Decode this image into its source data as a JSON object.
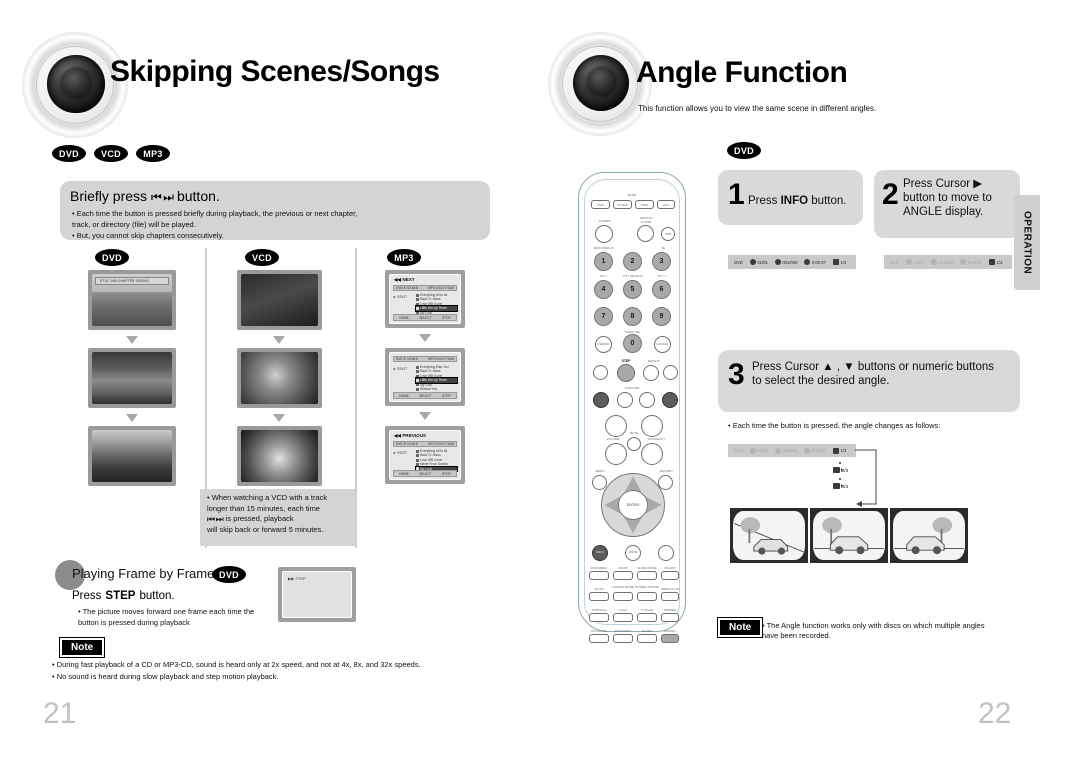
{
  "left_page": {
    "title": "Skipping Scenes/Songs",
    "page_number": "21",
    "media_badges": [
      "DVD",
      "VCD",
      "MP3"
    ],
    "intro_panel": {
      "heading_pre": "Briefly press",
      "heading_glyph": "⏮ ⏭",
      "heading_post": "button.",
      "bullets": [
        "• Each time the button is pressed briefly during playback, the previous or next chapter,",
        "   track, or directory (file) will be played.",
        "• But, you cannot skip chapters consecutively."
      ]
    },
    "columns": [
      {
        "badge": "DVD",
        "screens": [
          {
            "osd": "TITLE 2/45   CHAPTER 002/040",
            "scene": "beach"
          },
          {
            "osd": "",
            "scene": "cactus"
          },
          {
            "osd": "",
            "scene": "river"
          }
        ]
      },
      {
        "badge": "VCD",
        "screens": [
          {
            "osd": "",
            "scene": "dark"
          },
          {
            "osd": "",
            "scene": "chip"
          },
          {
            "osd": "",
            "scene": "raccoon"
          }
        ],
        "note": [
          "• When watching a VCD with a track",
          "   longer than 15 minutes, each time",
          "   is pressed, playback",
          "   will skip back or forward 5 minutes."
        ],
        "note_glyph": "⏮ ⏭"
      },
      {
        "badge": "MP3",
        "screens": [
          {
            "label": "NEXT",
            "bar_left": "DVD-R  02:48:8",
            "bar_right": "MP3  0:04:07  SAM",
            "left_col": "► ROOT",
            "files": [
              "Everything All In All",
              "Back To Jesus",
              "Love Will Cover",
              "Little Girl Up There",
              "My Lord",
              "Without You"
            ],
            "selected": 3,
            "foot": [
              "HOME",
              "SELECT",
              "STOP"
            ]
          },
          {
            "label": "",
            "bar_left": "DVD-R  02:48:8",
            "bar_right": "MP3  0:04:07  SAM",
            "left_col": "► ROOT",
            "files": [
              "Everything Else You",
              "Back To Jesus",
              "Love Will Cover",
              "Little Girl Up There",
              "My Lord",
              "Without You"
            ],
            "selected": 3,
            "foot": [
              "HOME",
              "SELECT",
              "STOP"
            ]
          },
          {
            "label": "PREVIOUS",
            "bar_left": "DVD-R  02:48:8",
            "bar_right": "MP3  0:04:07  SAM",
            "left_col": "► ROOT",
            "files": [
              "Everything All In All",
              "Back To Jesus",
              "Love Will Cover",
              "Never From Sorrow",
              "My Lord",
              "Without You"
            ],
            "selected": 4,
            "foot": [
              "HOME",
              "SELECT",
              "STOP"
            ]
          }
        ]
      }
    ],
    "frame_section": {
      "title": "Playing Frame by Frame",
      "badge": "DVD",
      "instruction_pre": "Press",
      "instruction_bold": "STEP",
      "instruction_post": "button.",
      "bullets": [
        "• The picture moves forward one frame each time the",
        "   button is pressed during playback"
      ],
      "screen_osd": "▶▶ STEP"
    },
    "note_label": "Note",
    "note_bullets": [
      "• During fast playback of a CD or MP3-CD, sound is heard only at 2x speed, and not at 4x, 8x, and 32x speeds.",
      "• No sound is heard during slow playback and step motion playback."
    ]
  },
  "right_page": {
    "title": "Angle Function",
    "subtitle": "This function allows you to view the same scene in different angles.",
    "page_number": "22",
    "media_badge": "DVD",
    "side_tab": "OPERATION",
    "steps": [
      {
        "num": "1",
        "lines": [
          "Press INFO button."
        ],
        "bold_word": "INFO"
      },
      {
        "num": "2",
        "lines": [
          "Press Cursor ▶",
          "button to move to",
          "ANGLE display."
        ]
      },
      {
        "num": "3",
        "lines": [
          "Press Cursor ▲ , ▼ buttons or numeric buttons",
          "to select the desired angle."
        ]
      }
    ],
    "osd_bar_active": {
      "disc": "DVD",
      "title": "01/01",
      "chapter": "001/040",
      "time": "0:00:37",
      "angle": "1/3"
    },
    "osd_bar_dim": {
      "disc": "DVD",
      "title": "01/01",
      "chapter": "001/040",
      "time": "0:00:37",
      "angle": "1/3"
    },
    "step3_bullet": "• Each time the button is pressed, the angle changes as follows:",
    "angle_cycle": [
      "1/3",
      "2/3",
      "3/3"
    ],
    "car_views": [
      "angle-1",
      "angle-2",
      "angle-3"
    ],
    "note_label": "Note",
    "note_bullets": [
      "• The Angle function works only with discs on which multiple angles",
      "   have been recorded."
    ],
    "remote": {
      "band_label": "BAND",
      "source_buttons": [
        "DVD",
        "TUNER",
        "TAPE",
        "AUX"
      ],
      "power_label": "POWER",
      "display_label": "DISPLAY\nCLOSE",
      "usb_label": "USB",
      "rds_label": "RDS DISPLAY",
      "ta_label": "TA",
      "pty_minus": "PTY -",
      "pty_search": "PTY SEARCH",
      "pty_plus": "PTY +",
      "numbers": [
        "1",
        "2",
        "3",
        "4",
        "5",
        "6",
        "7",
        "8",
        "9",
        "0"
      ],
      "video_sel": "VIDEO SEL.",
      "remain": "REMAIN",
      "cancel": "CANCEL",
      "step": "STEP",
      "repeat": "REPEAT",
      "dvd_usb": "DVD/USB",
      "volume": "VOLUME",
      "mute": "MUTE",
      "tuning": "TUNING/CH",
      "menu": "MENU",
      "return": "RETURN",
      "enter": "ENTER",
      "info": "INFO",
      "mode": "MODE",
      "sleep_grid": [
        [
          "DVD MENU",
          "ZOOM",
          "SLIDE MODE",
          "DIGEST"
        ],
        [
          "SLOW",
          "TUNING MODE",
          "POWER SOUND",
          "REPEAT A-B"
        ],
        [
          "SUBTITLE",
          "LOGO",
          "P. SCAN",
          "DIMMER"
        ],
        [
          "P/N MODE",
          "TITLE/DISC",
          "SLEEP",
          "DSP/EQ"
        ]
      ]
    }
  }
}
